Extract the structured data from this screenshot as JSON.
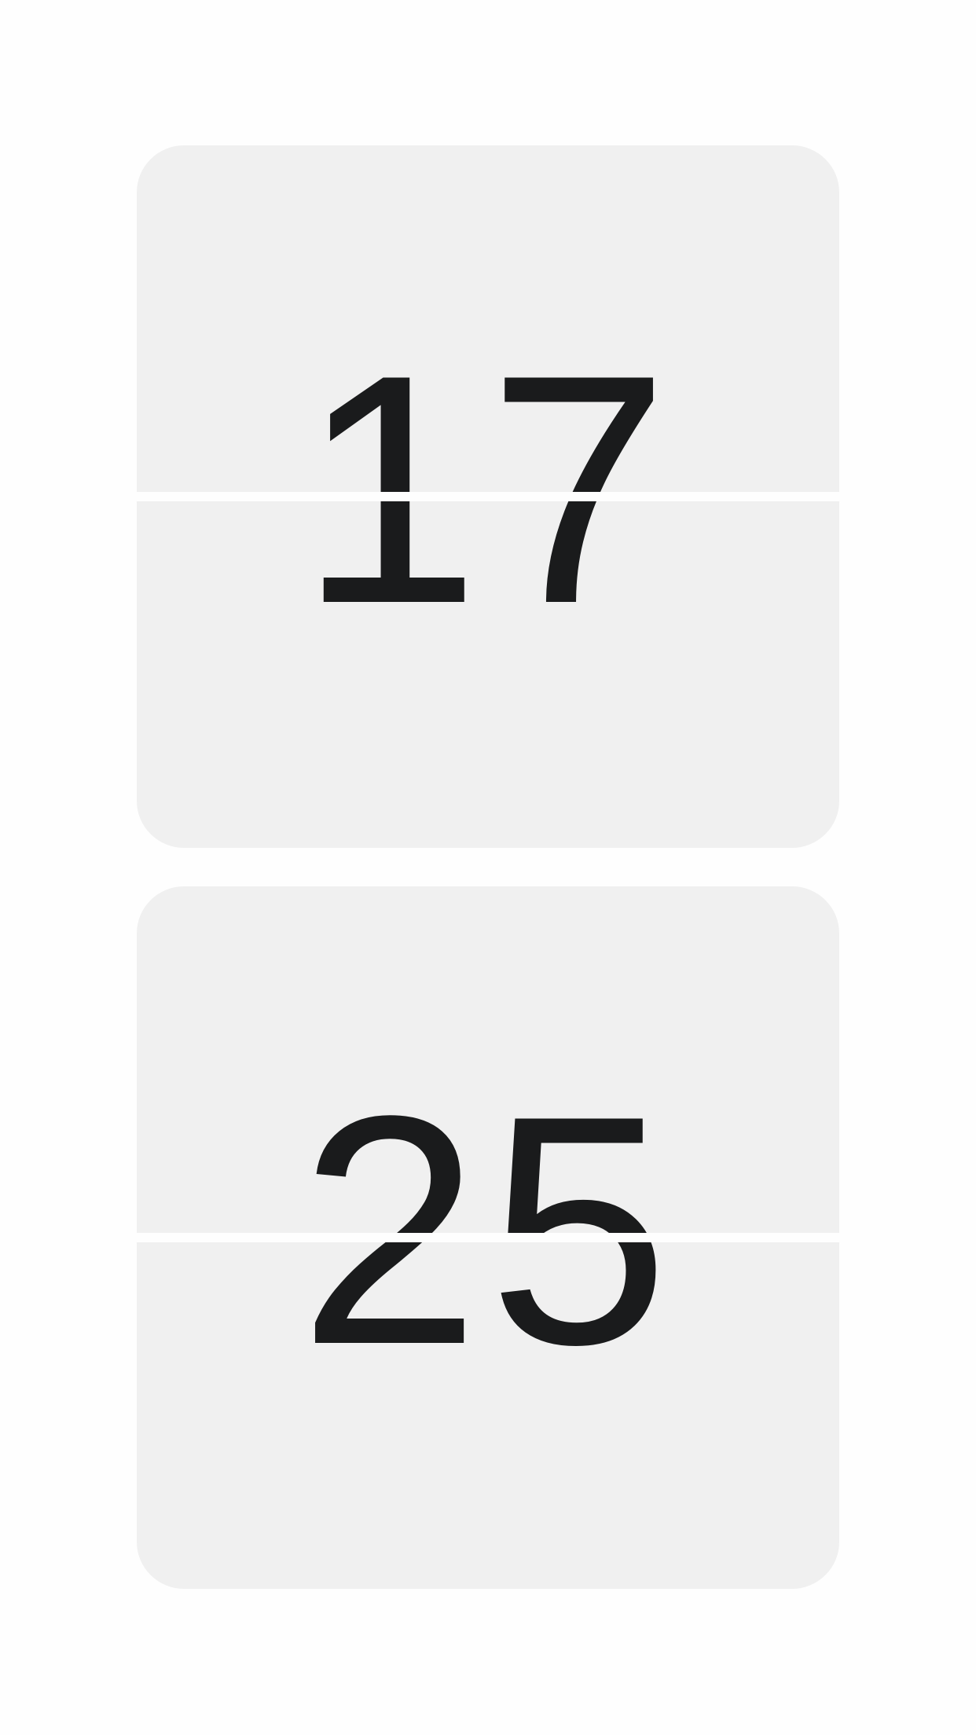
{
  "clock": {
    "hours": "17",
    "minutes": "25"
  },
  "colors": {
    "background": "#fefefe",
    "card": "#f0f0f0",
    "digits": "#1a1b1c"
  }
}
